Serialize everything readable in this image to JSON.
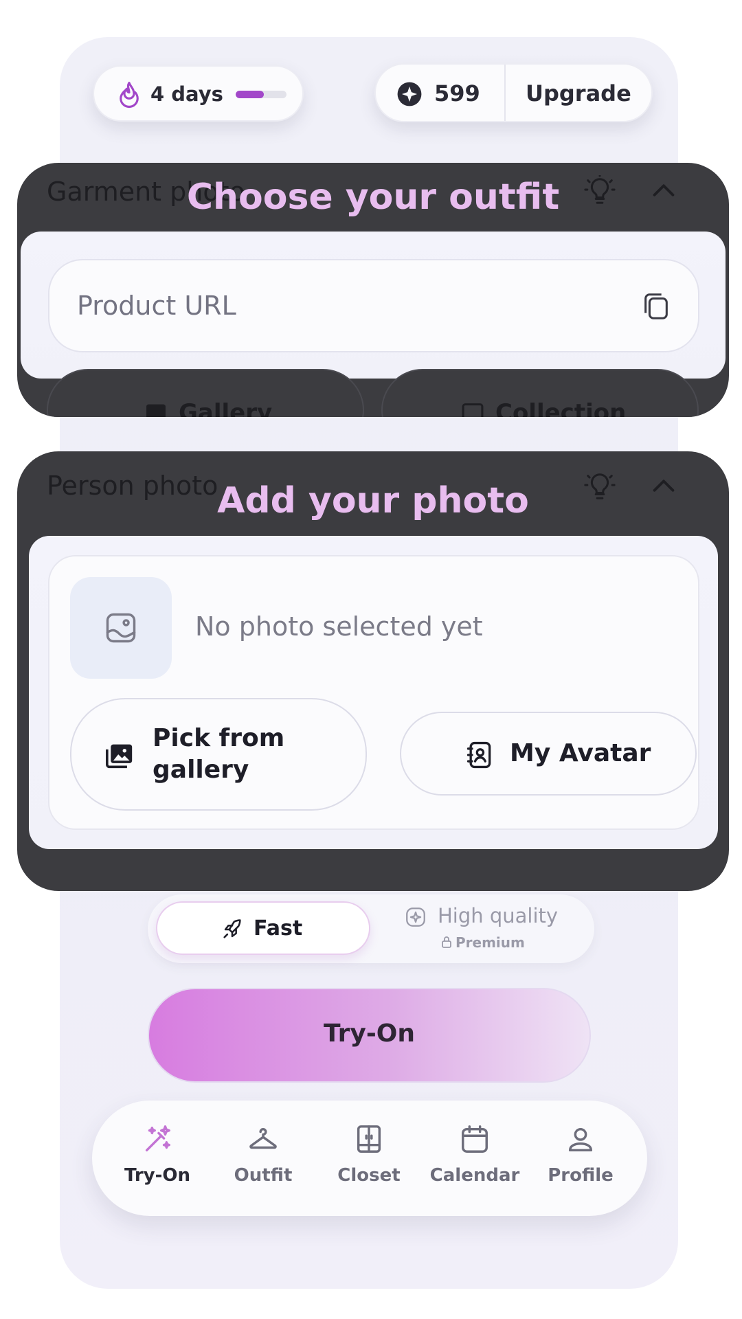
{
  "streak": {
    "label": "4 days",
    "progress": 0.55
  },
  "credits": {
    "count": "599",
    "upgrade_label": "Upgrade"
  },
  "garment_section": {
    "title": "Garment photo",
    "overlay_title": "Choose your outfit",
    "url_placeholder": "Product URL",
    "gallery_label": "Gallery",
    "collection_label": "Collection"
  },
  "person_section": {
    "title": "Person photo",
    "overlay_title": "Add your photo",
    "empty_text": "No photo selected yet",
    "pick_gallery_label": "Pick from gallery",
    "avatar_label": "My Avatar"
  },
  "speed": {
    "fast_label": "Fast",
    "hq_label": "High quality",
    "premium_label": "Premium"
  },
  "tryon_button": "Try-On",
  "tabs": [
    {
      "label": "Try-On",
      "icon": "magic-wand-icon",
      "active": true
    },
    {
      "label": "Outfit",
      "icon": "hanger-icon",
      "active": false
    },
    {
      "label": "Closet",
      "icon": "closet-icon",
      "active": false
    },
    {
      "label": "Calendar",
      "icon": "calendar-icon",
      "active": false
    },
    {
      "label": "Profile",
      "icon": "profile-icon",
      "active": false
    }
  ],
  "colors": {
    "accent": "#a247c9",
    "overlay": "#3c3c40",
    "overlay_title": "#e8bdef"
  }
}
